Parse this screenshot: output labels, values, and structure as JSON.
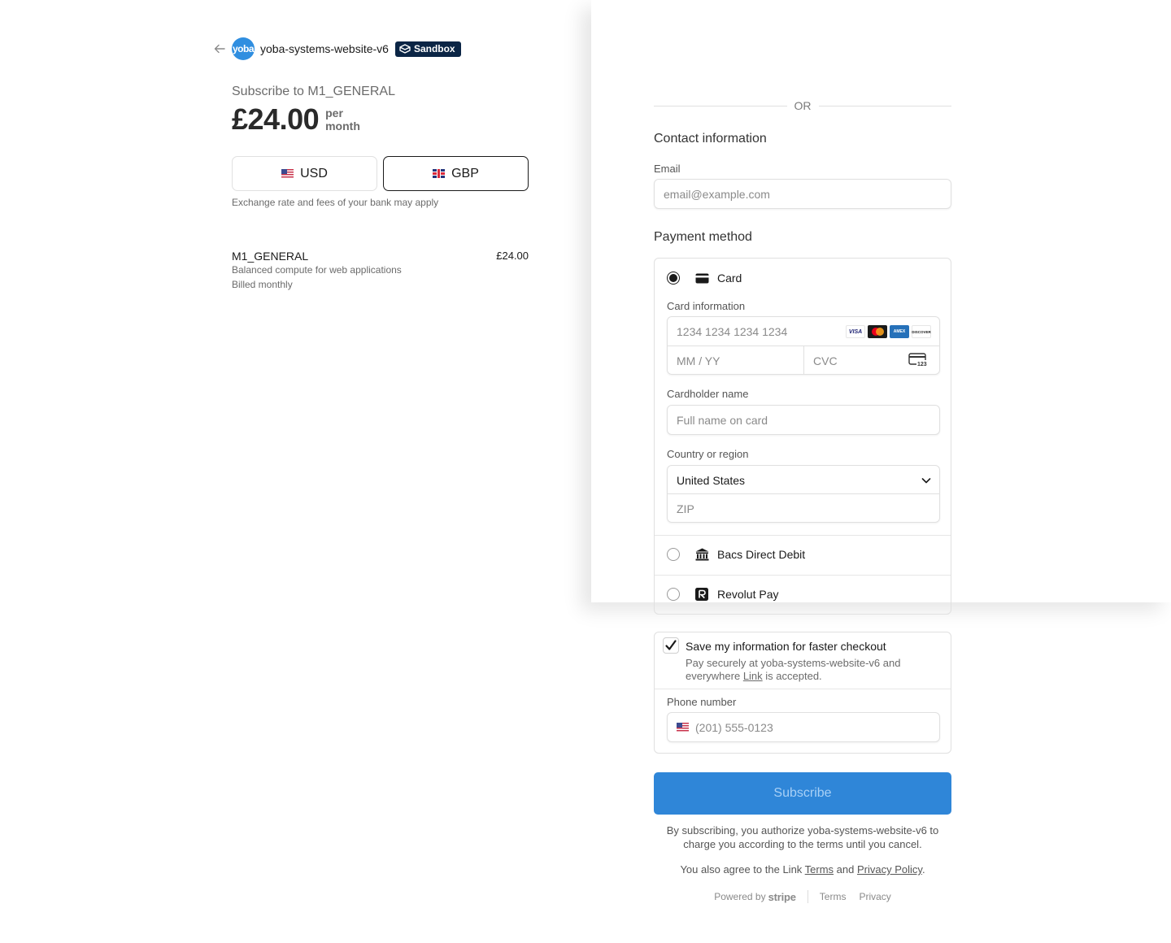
{
  "header": {
    "logo_text": "yoba",
    "merchant_name": "yoba-systems-website-v6",
    "badge": "Sandbox"
  },
  "summary": {
    "subscribe_title": "Subscribe to M1_GENERAL",
    "price": "£24.00",
    "per_line1": "per",
    "per_line2": "month",
    "currencies": [
      {
        "code": "USD",
        "selected": false
      },
      {
        "code": "GBP",
        "selected": true
      }
    ],
    "fx_note": "Exchange rate and fees of your bank may apply",
    "line_item": {
      "name": "M1_GENERAL",
      "price": "£24.00",
      "description": "Balanced compute for web applications",
      "billing": "Billed monthly"
    }
  },
  "form": {
    "or_text": "OR",
    "contact_title": "Contact information",
    "email_label": "Email",
    "email_placeholder": "email@example.com",
    "payment_title": "Payment method",
    "methods": [
      {
        "label": "Card",
        "selected": true,
        "icon": "card-icon"
      },
      {
        "label": "Bacs Direct Debit",
        "selected": false,
        "icon": "bank-icon"
      },
      {
        "label": "Revolut Pay",
        "selected": false,
        "icon": "revolut-icon"
      }
    ],
    "card_info_label": "Card information",
    "card_number_placeholder": "1234 1234 1234 1234",
    "expiry_placeholder": "MM / YY",
    "cvc_placeholder": "CVC",
    "card_brands": [
      "VISA",
      "Mastercard",
      "AMEX",
      "DISCOVER"
    ],
    "cardholder_label": "Cardholder name",
    "cardholder_placeholder": "Full name on card",
    "country_label": "Country or region",
    "country_value": "United States",
    "zip_placeholder": "ZIP"
  },
  "link": {
    "save_title": "Save my information for faster checkout",
    "save_checked": true,
    "save_desc_before": "Pay securely at yoba-systems-website-v6 and everywhere ",
    "save_desc_link": "Link",
    "save_desc_after": " is accepted.",
    "phone_label": "Phone number",
    "phone_placeholder": "(201) 555-0123"
  },
  "actions": {
    "subscribe_label": "Subscribe"
  },
  "legal": {
    "authorize_text": "By subscribing, you authorize yoba-systems-website-v6 to charge you according to the terms until you cancel.",
    "agree_before": "You also agree to the Link ",
    "terms_link": "Terms",
    "agree_and": " and ",
    "privacy_link": "Privacy Policy",
    "agree_after": "."
  },
  "footer": {
    "powered_by": "Powered by",
    "stripe": "stripe",
    "terms": "Terms",
    "privacy": "Privacy"
  },
  "colors": {
    "accent": "#2f86d8",
    "sandbox_badge": "#0b2545",
    "logo_bg": "#2f8ee0"
  }
}
